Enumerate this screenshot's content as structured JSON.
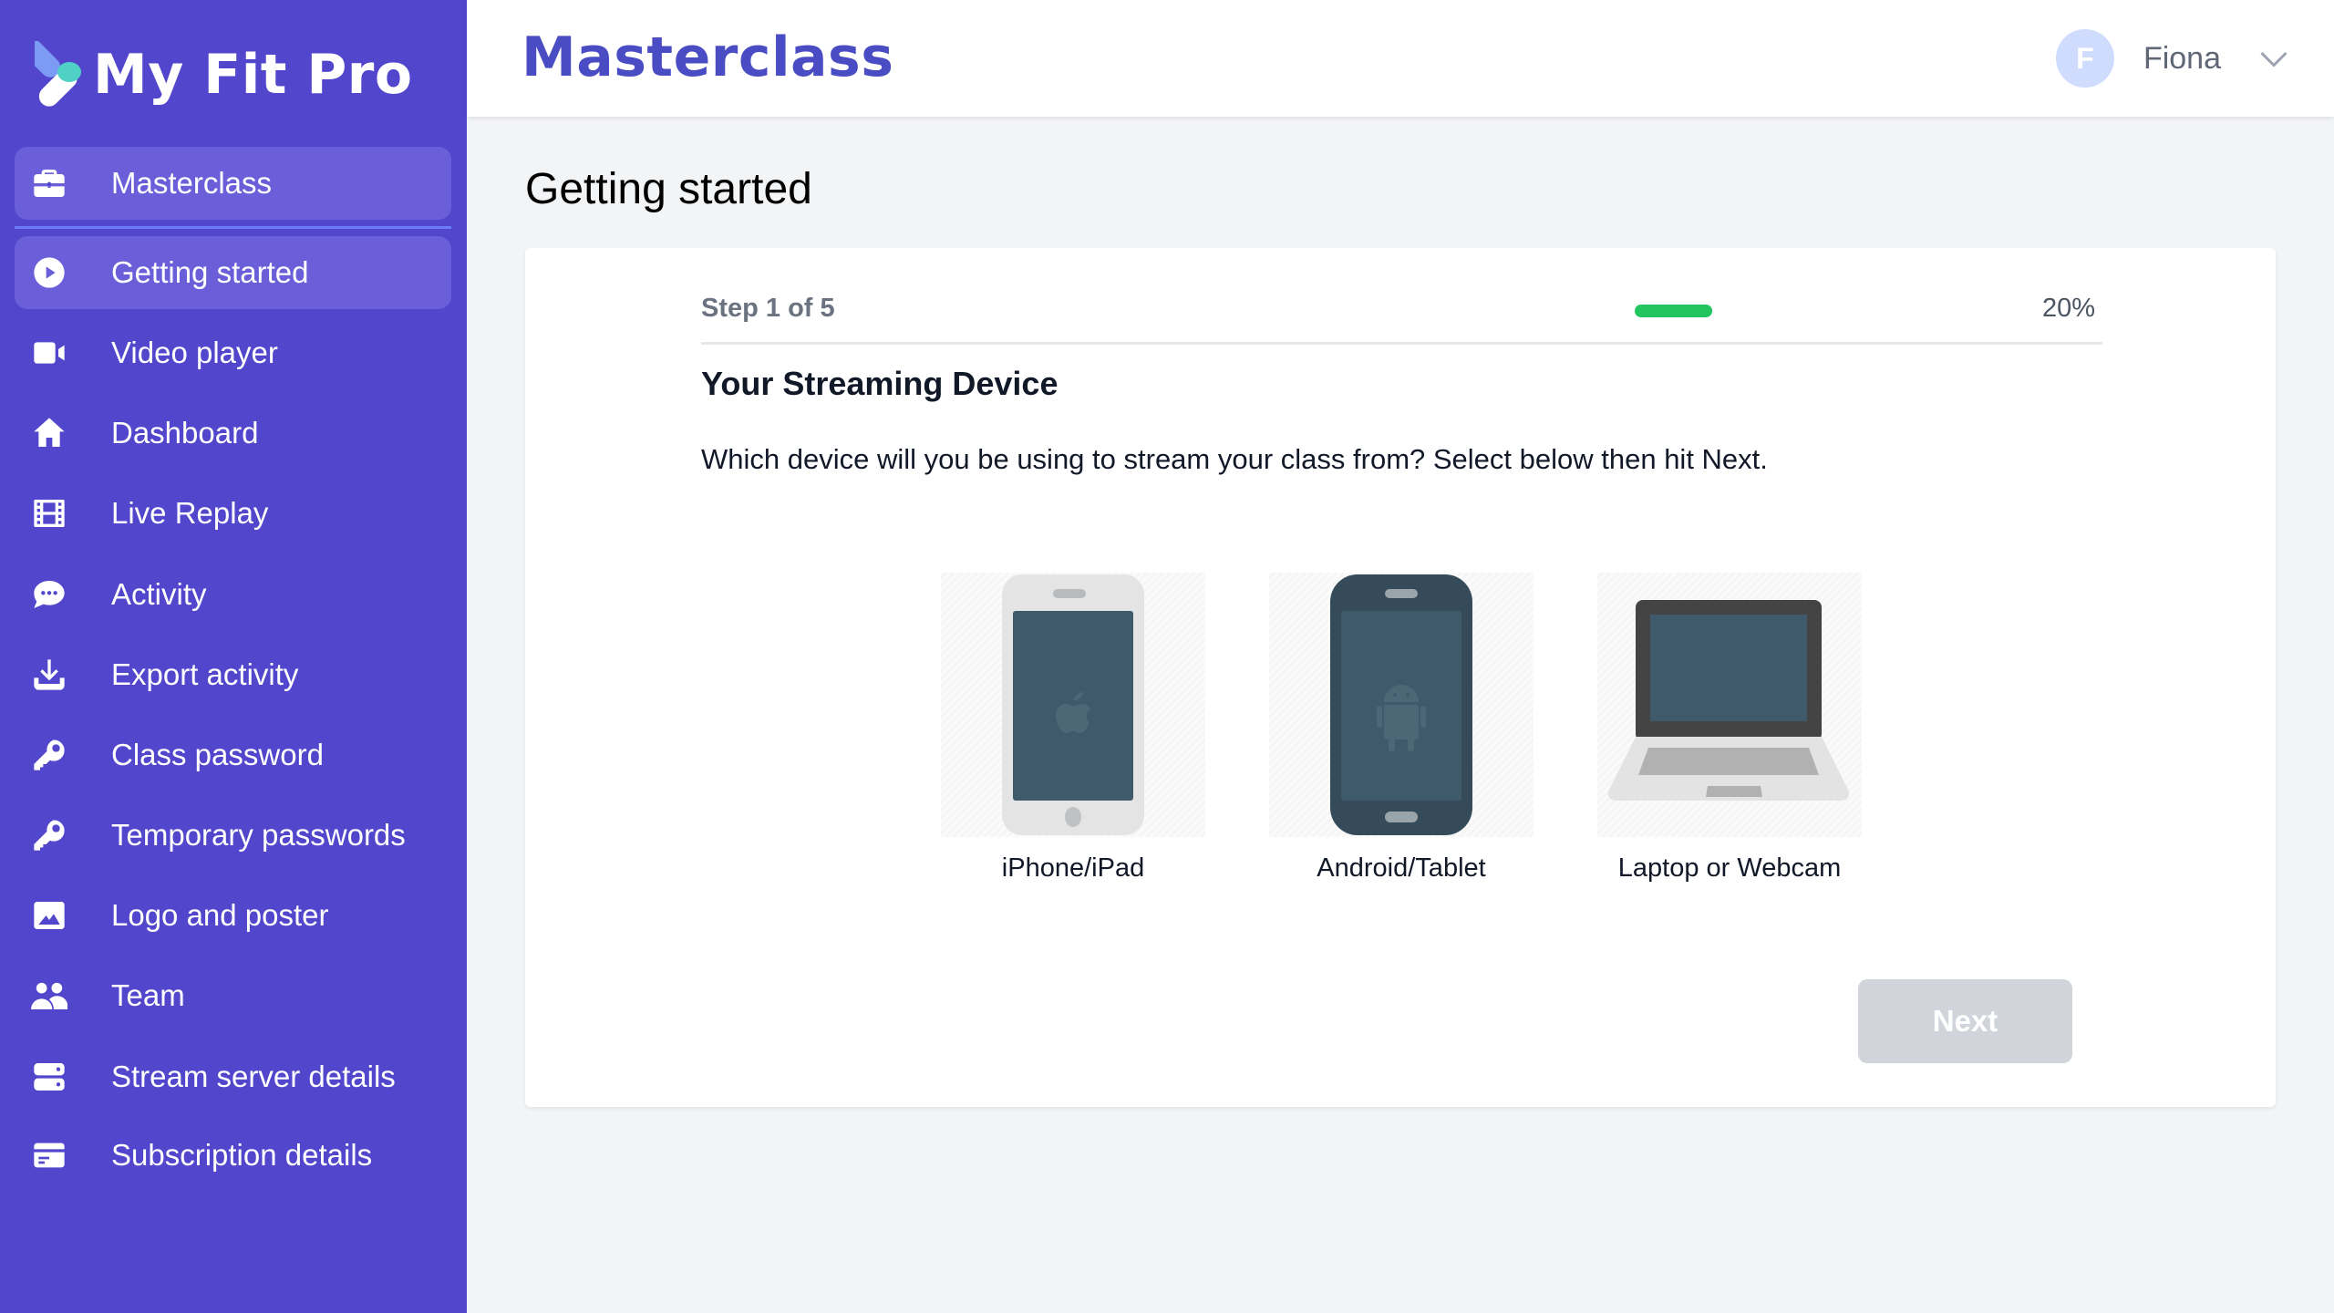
{
  "app": {
    "name": "My Fit Pro"
  },
  "header": {
    "title": "Masterclass",
    "user": {
      "initial": "F",
      "name": "Fiona"
    }
  },
  "sidebar": {
    "items": [
      {
        "label": "Masterclass",
        "icon": "briefcase-icon",
        "active": true
      },
      {
        "label": "Getting started",
        "icon": "play-circle-icon",
        "active": true
      },
      {
        "label": "Video player",
        "icon": "video-camera-icon"
      },
      {
        "label": "Dashboard",
        "icon": "home-icon"
      },
      {
        "label": "Live Replay",
        "icon": "film-icon"
      },
      {
        "label": "Activity",
        "icon": "chat-bubble-icon"
      },
      {
        "label": "Export activity",
        "icon": "download-icon"
      },
      {
        "label": "Class password",
        "icon": "key-icon"
      },
      {
        "label": "Temporary passwords",
        "icon": "key-icon"
      },
      {
        "label": "Logo and poster",
        "icon": "image-icon"
      },
      {
        "label": "Team",
        "icon": "users-icon"
      },
      {
        "label": "Stream server details",
        "icon": "server-icon"
      },
      {
        "label": "Subscription details",
        "icon": "credit-card-icon"
      }
    ]
  },
  "main": {
    "page_title": "Getting started",
    "wizard": {
      "step_label": "Step 1 of 5",
      "progress_percent": 20,
      "progress_text": "20%",
      "section_title": "Your Streaming Device",
      "description": "Which device will you be using to stream your class from? Select below then hit Next.",
      "devices": [
        {
          "label": "iPhone/iPad",
          "icon": "iphone-icon"
        },
        {
          "label": "Android/Tablet",
          "icon": "android-phone-icon"
        },
        {
          "label": "Laptop or Webcam",
          "icon": "laptop-icon"
        }
      ],
      "next_label": "Next",
      "next_disabled": true
    }
  },
  "colors": {
    "sidebar_bg": "#5146cc",
    "active_item_bg": "#6a5fd8",
    "brand_title": "#4a4cc3",
    "progress": "#22c55e",
    "button_disabled": "#d1d5db"
  }
}
